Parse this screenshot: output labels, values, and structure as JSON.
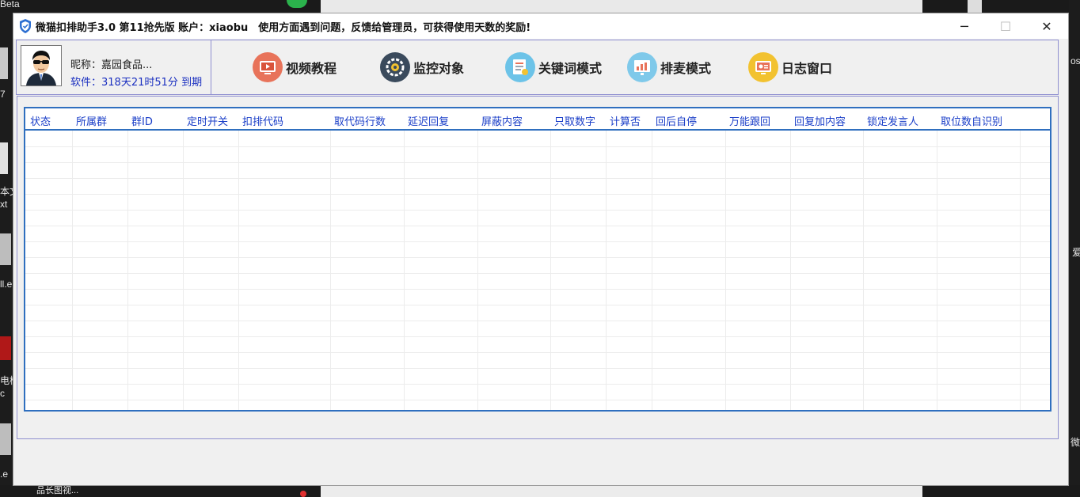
{
  "window": {
    "title": "微猫扣排助手3.0 第11抢先版 账户：xiaobu　使用方面遇到问题，反馈给管理员，可获得使用天数的奖励!",
    "minimize_glyph": "─",
    "maximize_glyph": "☐",
    "close_glyph": "✕"
  },
  "profile": {
    "nickname_label": "昵称：",
    "nickname_value": "嘉园食品...",
    "software_label": "软件：",
    "software_value": "318天21时51分",
    "expire_label": "到期"
  },
  "toolbar": {
    "items": [
      {
        "label": "视频教程",
        "icon": "video-icon",
        "color": "#e8735a"
      },
      {
        "label": "监控对象",
        "icon": "monitor-target-icon",
        "color": "#3a4a5c"
      },
      {
        "label": "关键词模式",
        "icon": "keyword-icon",
        "color": "#6cc3e8"
      },
      {
        "label": "排麦模式",
        "icon": "queue-chart-icon",
        "color": "#7fc9ea"
      },
      {
        "label": "日志窗口",
        "icon": "log-window-icon",
        "color": "#f2c230"
      }
    ]
  },
  "table": {
    "columns": [
      "状态",
      "所属群",
      "群ID",
      "定时开关",
      "扣排代码",
      "取代码行数",
      "延迟回复",
      "屏蔽内容",
      "只取数字",
      "计算否",
      "回后自停",
      "万能跟回",
      "回复加内容",
      "锁定发言人",
      "取位数自识别"
    ],
    "rows": []
  },
  "desktop": {
    "left_labels": [
      "Beta",
      "7",
      "本文",
      "xt",
      "ll.e",
      "电框",
      "c",
      ".e"
    ],
    "right_labels": [
      "os",
      "爱",
      "微"
    ],
    "bottom_label": "品长图视..."
  }
}
